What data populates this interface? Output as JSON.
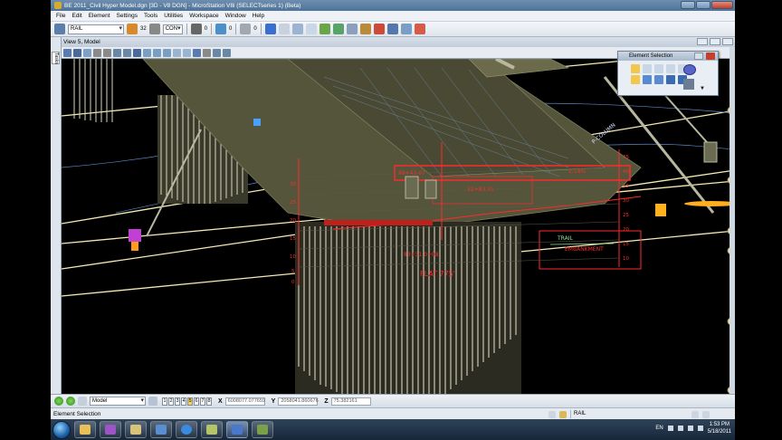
{
  "window": {
    "title": "BE 2011_Civil Hyper Model.dgn [3D - V8 DGN] - MicroStation V8i (SELECTseries 1) (Beta)"
  },
  "menu": [
    "File",
    "Edit",
    "Element",
    "Settings",
    "Tools",
    "Utilities",
    "Workspace",
    "Window",
    "Help"
  ],
  "toolbar": {
    "level_value": "RAIL",
    "color_value": "32",
    "linestyle_value": "CON",
    "weight_value": "0",
    "transparency_value": "0",
    "priority_value": "0"
  },
  "view": {
    "title": "View 5, Model",
    "side_tab": "Tasks"
  },
  "element_selection": {
    "title": "Element Selection"
  },
  "viewport_labels": [
    {
      "text": "99+43.07",
      "color": "#ff2a2a"
    },
    {
      "text": "2.14%",
      "color": "#ff2a2a"
    },
    {
      "text": "32+83.31",
      "color": "#ff2a2a"
    },
    {
      "text": "83+31 0+08",
      "color": "#ff2a2a"
    },
    {
      "text": "EMBANKMENT",
      "color": "#ff2a2a"
    },
    {
      "text": "FLAT 775'",
      "color": "#ff2a2a"
    },
    {
      "text": "TRAIL",
      "color": "#8fe68f"
    },
    {
      "text": "P-COLUMN",
      "color": "#cfe0ff"
    }
  ],
  "axis_ticks_left": [
    "30",
    "25",
    "20",
    "15",
    "10",
    "5",
    "0"
  ],
  "axis_ticks_right": [
    "45",
    "40",
    "35",
    "30",
    "25",
    "20",
    "15",
    "10"
  ],
  "bottom": {
    "model_value": "Model",
    "view_numbers": [
      "1",
      "2",
      "3",
      "4",
      "5",
      "6",
      "7",
      "8"
    ],
    "active_view": "5",
    "x_label": "X",
    "x_value": "6008077.077659",
    "y_label": "Y",
    "y_value": "2058041.860676",
    "z_label": "Z",
    "z_value": "75.382161"
  },
  "status": {
    "left_text": "Element Selection",
    "level": "RAIL"
  },
  "taskbar": {
    "language": "EN",
    "time": "1:53 PM",
    "date": "5/18/2011"
  },
  "colors": {
    "title_bar": "#5a7ea3",
    "rail_lines": "#f3ecb5",
    "annotation_red": "#ff2a2a",
    "deck": "#55553c",
    "piles": "#d9d6b8"
  }
}
